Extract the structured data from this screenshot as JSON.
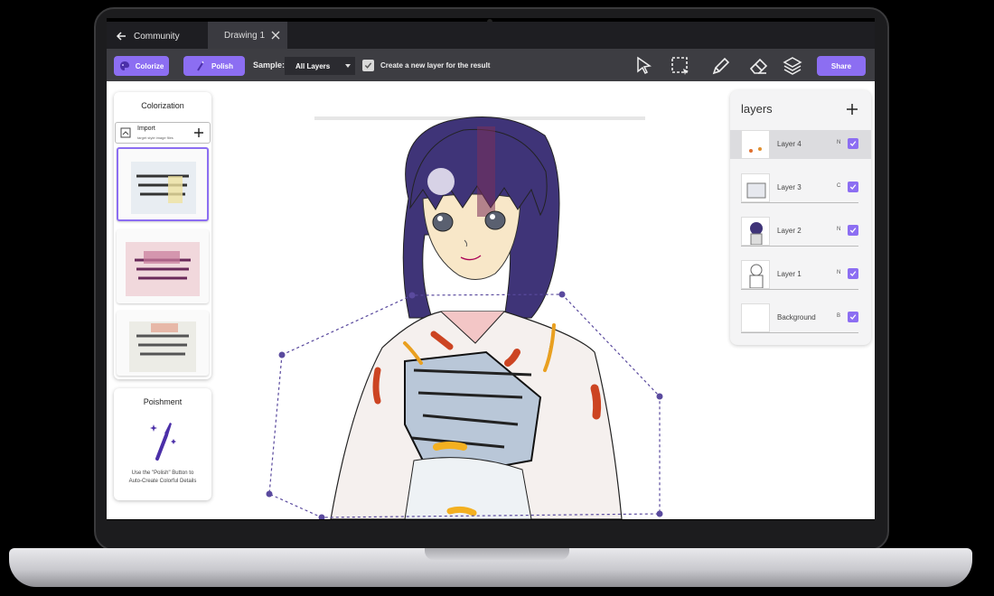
{
  "titlebar": {
    "back_label": "Community",
    "tab_label": "Drawing 1"
  },
  "toolbar": {
    "colorize_label": "Colorize",
    "polish_label": "Polish",
    "sample_label": "Sample:",
    "sample_value": "All Layers",
    "create_layer_label": "Create a new layer for the result",
    "create_layer_checked": true,
    "share_label": "Share",
    "tools": [
      "select-arrow-icon",
      "lasso-select-icon",
      "pencil-icon",
      "eraser-icon",
      "layers-icon"
    ]
  },
  "colorization": {
    "title": "Colorization",
    "import_label": "Import",
    "import_sub": "target style image files"
  },
  "poishment": {
    "title": "Poishment",
    "description_line1": "Use the \"Polish\" Button to",
    "description_line2": "Auto-Create Colorful Details"
  },
  "layers": {
    "title": "layers",
    "items": [
      {
        "name": "Layer 4",
        "mode": "N",
        "visible": true,
        "active": true
      },
      {
        "name": "Layer 3",
        "mode": "C",
        "visible": true,
        "active": false
      },
      {
        "name": "Layer 2",
        "mode": "N",
        "visible": true,
        "active": false
      },
      {
        "name": "Layer 1",
        "mode": "N",
        "visible": true,
        "active": false
      },
      {
        "name": "Background",
        "mode": "B",
        "visible": true,
        "active": false
      }
    ]
  },
  "colors": {
    "accent": "#8c6ef2",
    "titlebar": "#1e1e22",
    "toolbar": "#3d3d42",
    "hair": "#3f3478",
    "selection": "#5a4a9e"
  }
}
